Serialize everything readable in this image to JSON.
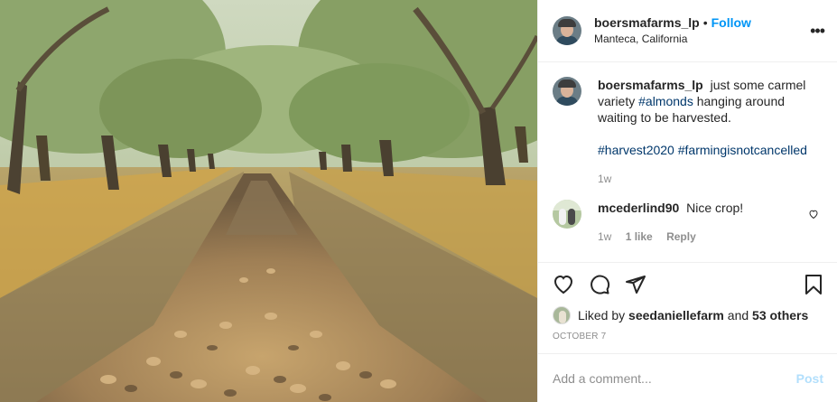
{
  "header": {
    "username": "boersmafarms_lp",
    "separator": "•",
    "follow_label": "Follow",
    "location": "Manteca, California",
    "more_icon": "ellipsis-icon"
  },
  "caption": {
    "username": "boersmafarms_lp",
    "text_before": "just some carmel variety",
    "tag_almonds": "#almonds",
    "text_after": "hanging around waiting to be harvested.",
    "tag_harvest": "#harvest2020",
    "tag_farming": "#farmingisnotcancelled",
    "age": "1w"
  },
  "comment": {
    "username": "mcederlind90",
    "text": "Nice crop!",
    "age": "1w",
    "likes": "1 like",
    "reply_label": "Reply"
  },
  "likes": {
    "prefix": "Liked by",
    "user": "seedaniellefarm",
    "conj": "and",
    "others": "53 others"
  },
  "date": "OCTOBER 7",
  "add_comment": {
    "placeholder": "Add a comment...",
    "post_label": "Post"
  },
  "colors": {
    "accent": "#0095f6",
    "post_disabled": "#b2dffc",
    "hashtag": "#00376b",
    "muted": "#8e8e8e"
  }
}
